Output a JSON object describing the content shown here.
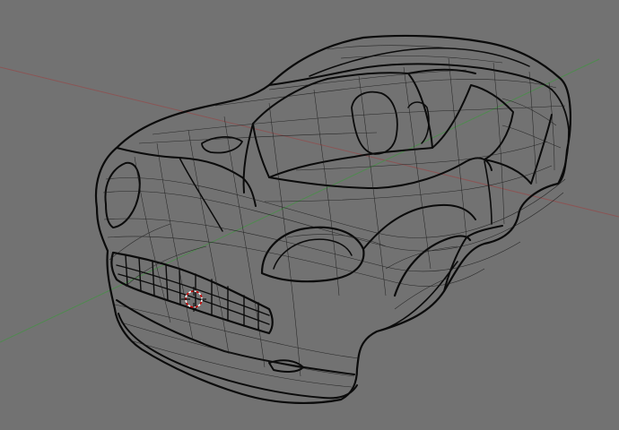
{
  "viewport": {
    "background_color": "#727272",
    "x_axis_color": "#8a5555",
    "y_axis_color": "#4f8a4f",
    "wire_color": "#0b0b0b",
    "cursor_colors": [
      "#ffffff",
      "#cc0000"
    ]
  },
  "scene": {
    "object_name": "car-body-wireframe",
    "display_mode": "wireframe"
  }
}
